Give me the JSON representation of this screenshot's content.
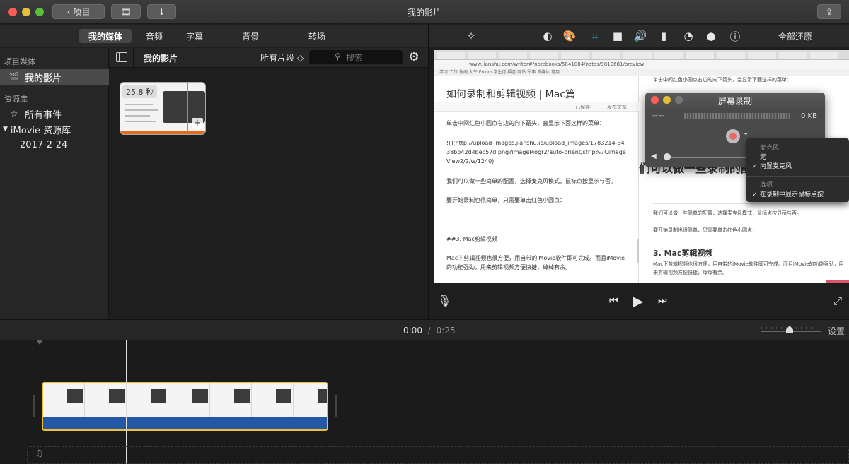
{
  "window": {
    "title": "我的影片"
  },
  "toolbar": {
    "back_label": "项目"
  },
  "tabs": [
    {
      "label": "我的媒体",
      "active": true
    },
    {
      "label": "音频"
    },
    {
      "label": "字幕"
    },
    {
      "label": "背景"
    },
    {
      "label": "转场"
    }
  ],
  "viewer_tools": {
    "reset_all": "全部还原"
  },
  "sidebar": {
    "project_media_header": "项目媒体",
    "project_item": "我的影片",
    "library_header": "资源库",
    "all_events": "所有事件",
    "library_name": "iMovie 资源库",
    "event_date": "2017-2-24"
  },
  "browser": {
    "title": "我的影片",
    "filter": "所有片段 ◇",
    "search_placeholder": "搜索",
    "clip_duration": "25.8 秒"
  },
  "preview_content": {
    "url": "www.jianshu.com/writer#/notebooks/5841084/notes/9810681/preview",
    "bookmarks": "学习   工作   休闲   大牛   Ercom   学生信   福音   网站   军事   自媒体   常用",
    "editor_title": "如何录制和剪辑视频 | Mac篇",
    "editor_toolbar": "已保存",
    "editor_toolbar_publish": "发布文章",
    "p1": "单击中间红色小圆点右边的向下箭头，会显示下面这样的菜单：",
    "p2": "![](http://upload-images.jianshu.io/upload_images/1783214-3438bb42d4bec57d.png?imageMogr2/auto-orient/strip%7CimageView2/2/w/1240)",
    "p3": "我们可以做一些简单的配置，选择麦克风模式，鼠标点按显示与否。",
    "p4": "要开始录制也很简单，只需要单击红色小圆点：",
    "p5": "##3. Mac剪辑视频",
    "p6": "Mac下剪辑视频也很方便，用自带的iMovie软件即可完成。而且iMovie的功能强劲，用来剪辑视频方便快捷，绰绰有余。",
    "pv_top": "单击中间红色小圆点右边的向下箭头，会显示下面这样的菜单：",
    "pv_big": "们可以做一些录制的配",
    "pv_p1": "我们可以做一些简单的配置，选择麦克风模式，鼠标点按显示与否。",
    "pv_p2": "要开始录制也很简单，只需要单击红色小圆点：",
    "pv_h3": "3. Mac剪辑视频",
    "pv_p3": "Mac下剪辑视频也很方便，用自带的iMovie软件即可完成。而且iMovie的功能强劲，用来剪辑视频方便快捷，绰绰有余。",
    "rec_title": "屏幕录制",
    "rec_time": "--:--",
    "rec_size": "0 KB",
    "menu_mic_header": "麦克风",
    "menu_none": "无",
    "menu_builtin": "内置麦克风",
    "menu_options_header": "选项",
    "menu_show_clicks": "在录制中显示鼠标点按",
    "checkmark": "✓"
  },
  "timeline": {
    "current": "0:00",
    "separator": "/",
    "duration": "0:25",
    "settings_label": "设置"
  },
  "colors": {
    "accent": "#2aa3f7",
    "clip_border": "#f2c12e",
    "audio": "#2458a6"
  }
}
